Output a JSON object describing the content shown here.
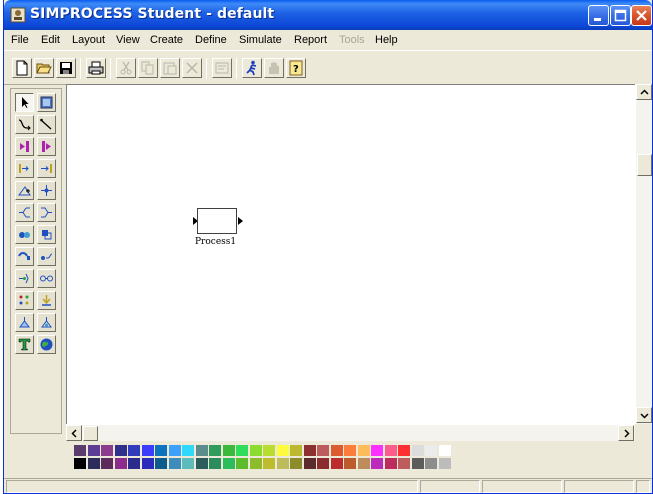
{
  "window": {
    "title": "SIMPROCESS Student - default",
    "title_color": "#0a46d6",
    "controls": [
      "minimize-icon",
      "maximize-icon",
      "close-icon"
    ]
  },
  "menu": {
    "items": [
      {
        "label": "File",
        "enabled": true
      },
      {
        "label": "Edit",
        "enabled": true
      },
      {
        "label": "Layout",
        "enabled": true
      },
      {
        "label": "View",
        "enabled": true
      },
      {
        "label": "Create",
        "enabled": true
      },
      {
        "label": "Define",
        "enabled": true
      },
      {
        "label": "Simulate",
        "enabled": true
      },
      {
        "label": "Report",
        "enabled": true
      },
      {
        "label": "Tools",
        "enabled": false
      },
      {
        "label": "Help",
        "enabled": true
      }
    ]
  },
  "toolbar": {
    "buttons": [
      {
        "icon": "new-icon",
        "enabled": true
      },
      {
        "icon": "open-icon",
        "enabled": true
      },
      {
        "icon": "save-icon",
        "enabled": true
      },
      {
        "icon": "print-icon",
        "enabled": true
      },
      {
        "icon": "cut-icon",
        "enabled": false
      },
      {
        "icon": "copy-icon",
        "enabled": false
      },
      {
        "icon": "paste-icon",
        "enabled": false
      },
      {
        "icon": "delete-icon",
        "enabled": false
      },
      {
        "icon": "properties-icon",
        "enabled": false
      },
      {
        "icon": "run-simulation-icon",
        "enabled": true
      },
      {
        "icon": "stop-hand-icon",
        "enabled": false
      },
      {
        "icon": "help-icon",
        "enabled": true
      }
    ]
  },
  "palette": {
    "tools": [
      "select-arrow-icon",
      "process-icon",
      "connector-curved-icon",
      "connector-straight-icon",
      "generate-icon",
      "dispose-icon",
      "entry-icon",
      "exit-icon",
      "assign-icon",
      "branch-icon",
      "merge-icon",
      "split-icon",
      "join-icon",
      "batch-icon",
      "unbatch-icon",
      "transform-icon",
      "gate-icon",
      "synchronize-icon",
      "transfer-icon",
      "replicate-icon",
      "assemble-icon",
      "disassemble-icon",
      "resource-icon",
      "resource-free-icon",
      "text-tool-icon",
      "globe-icon"
    ]
  },
  "canvas": {
    "process_label": "Process1"
  },
  "colors": {
    "swatches_row1": [
      "#5c3c6c",
      "#5c3c94",
      "#8c3c8c",
      "#30308c",
      "#303cbc",
      "#3c3cfc",
      "#0c74bc",
      "#3ca0fc",
      "#30d8fc",
      "#5c8c8c",
      "#309c5c",
      "#3cb83c",
      "#30dc5c",
      "#8cdc30",
      "#b8dc30",
      "#fcfc3c",
      "#bcb830",
      "#8c3030",
      "#bc5c5c",
      "#dc5c30",
      "#fc7c3c",
      "#fcbc5c",
      "#fc30fc",
      "#fc5c8c",
      "#fc3030",
      "#dcdcdc",
      "#ececec",
      "#ffffff"
    ],
    "swatches_row2": [
      "#000000",
      "#2c2c5c",
      "#5c2c5c",
      "#8c2c8c",
      "#2c2c8c",
      "#2c2cbc",
      "#0c5c8c",
      "#3c8cbc",
      "#5cbcbc",
      "#2c5c5c",
      "#2c8c5c",
      "#2cbc5c",
      "#5cbc2c",
      "#8cbc2c",
      "#bcbc2c",
      "#bcbc5c",
      "#8c8c2c",
      "#5c2c2c",
      "#8c2c2c",
      "#bc2c2c",
      "#bc5c2c",
      "#bc8c5c",
      "#bc2cbc",
      "#bc2c5c",
      "#bc5c5c",
      "#5c5c5c",
      "#8c8c8c",
      "#bcbcbc"
    ]
  }
}
